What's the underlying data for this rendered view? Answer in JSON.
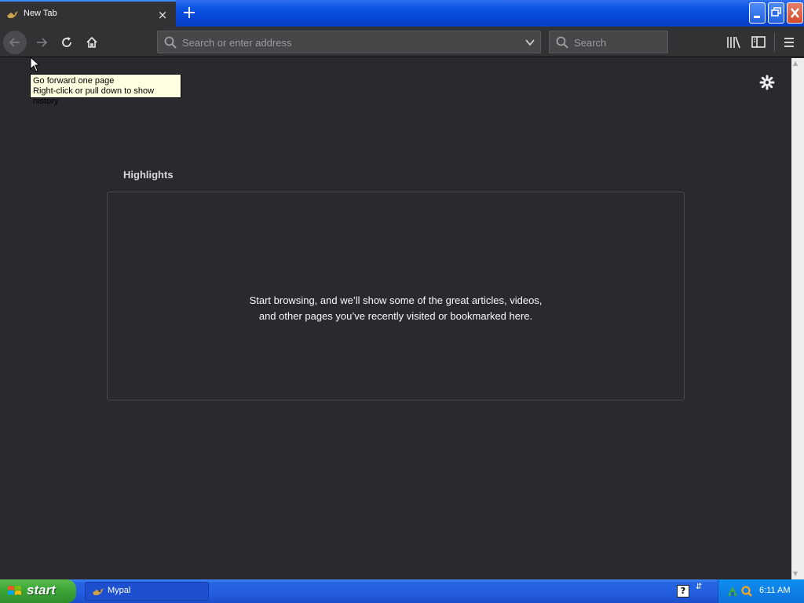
{
  "window": {
    "tab_title": "New Tab",
    "new_tab_symbol": "+",
    "close_tab_symbol": "×"
  },
  "toolbar": {
    "address_placeholder": "Search or enter address",
    "search_placeholder": "Search"
  },
  "content": {
    "highlights_title": "Highlights",
    "empty_message": "Start browsing, and we’ll show some of the great articles, videos, and other pages you’ve recently visited or bookmarked here."
  },
  "tooltip": {
    "line1": "Go forward one page",
    "line2": "Right-click or pull down to show history"
  },
  "taskbar": {
    "start_label": "start",
    "task_label": "Mypal",
    "clock": "6:11 AM",
    "help_symbol": "?"
  },
  "colors": {
    "content_bg": "#2a2a2e",
    "toolbar_bg": "#323234",
    "xp_blue": "#245de1",
    "start_green": "#3da83a"
  },
  "icons": [
    "mypal-favicon",
    "close-icon",
    "plus-icon",
    "back-arrow-icon",
    "forward-arrow-icon",
    "reload-icon",
    "home-icon",
    "search-icon",
    "chevron-down-icon",
    "library-icon",
    "sidebar-icon",
    "hamburger-menu-icon",
    "gear-icon",
    "windows-logo-icon"
  ]
}
